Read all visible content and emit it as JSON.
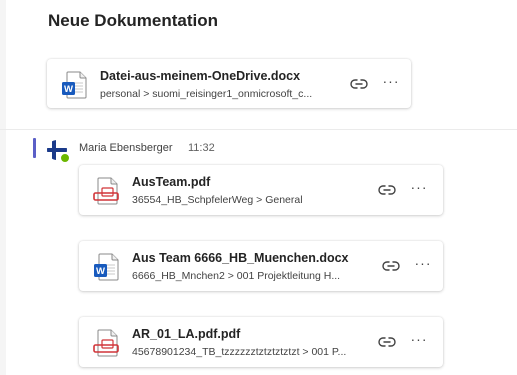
{
  "section": {
    "title": "Neue Dokumentation"
  },
  "top_card": {
    "icon": "word-docx-icon",
    "name": "Datei-aus-meinem-OneDrive.docx",
    "path": "personal > suomi_reisinger1_onmicrosoft_c..."
  },
  "message": {
    "sender": "Maria Ebensberger",
    "time": "11:32",
    "presence": "available",
    "accent_color": "#5b5fc7",
    "presence_color": "#6bb700",
    "attachments": [
      {
        "icon": "pdf-icon",
        "name": "AusTeam.pdf",
        "path": "36554_HB_SchpfelerWeg > General"
      },
      {
        "icon": "word-docx-icon",
        "name": "Aus Team 6666_HB_Muenchen.docx",
        "path": "6666_HB_Mnchen2 > 001 Projektleitung H..."
      },
      {
        "icon": "pdf-icon",
        "name": "AR_01_LA.pdf.pdf",
        "path": "45678901234_TB_tzzzzzztztztztztzt > 001 P..."
      }
    ]
  },
  "colors": {
    "word_blue": "#185abd",
    "pdf_red": "#d13438"
  }
}
